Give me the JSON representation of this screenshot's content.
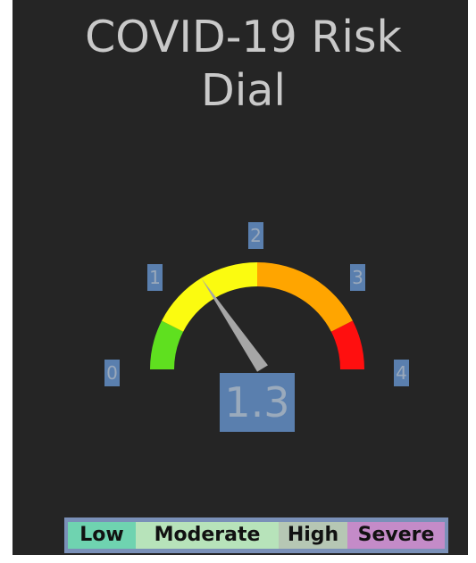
{
  "title": {
    "line1": "COVID-19 Risk",
    "line2": "Dial"
  },
  "gauge": {
    "min": 0,
    "max": 4,
    "value": 1.3,
    "value_label": "1.3",
    "ticks": [
      "0",
      "1",
      "2",
      "3",
      "4"
    ],
    "bands": [
      {
        "from": 0,
        "to": 0.6,
        "color": "#5fe01f"
      },
      {
        "from": 0.6,
        "to": 2,
        "color": "#fbfb10"
      },
      {
        "from": 2,
        "to": 3.4,
        "color": "#ffa500"
      },
      {
        "from": 3.4,
        "to": 4,
        "color": "#ff0f0f"
      }
    ],
    "needle_color": "#a6a6a6"
  },
  "legend": [
    {
      "label": "Low",
      "color": "#6fd3b0"
    },
    {
      "label": "Moderate",
      "color": "#b7e3ba"
    },
    {
      "label": "High",
      "color": "#b6c7b4"
    },
    {
      "label": "Severe",
      "color": "#c48bc8"
    }
  ],
  "colors": {
    "background": "#252525",
    "title_text": "#c9c9c9",
    "label_box": "#5a7fae"
  }
}
